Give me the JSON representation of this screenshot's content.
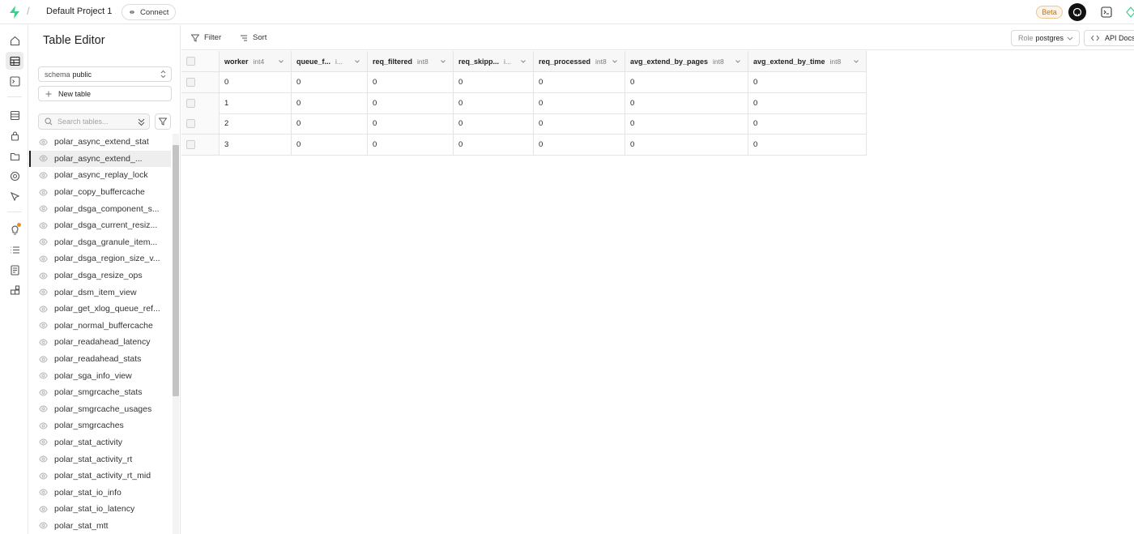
{
  "topbar": {
    "project": "Default Project 1",
    "connect": "Connect",
    "beta": "Beta"
  },
  "sidebar": {
    "title": "Table Editor",
    "schema_label": "schema",
    "schema_value": "public",
    "new_table": "New table",
    "search_placeholder": "Search tables...",
    "tables": [
      "polar_async_extend_stat",
      "polar_async_extend_...",
      "polar_async_replay_lock",
      "polar_copy_buffercache",
      "polar_dsga_component_s...",
      "polar_dsga_current_resiz...",
      "polar_dsga_granule_item...",
      "polar_dsga_region_size_v...",
      "polar_dsga_resize_ops",
      "polar_dsm_item_view",
      "polar_get_xlog_queue_ref...",
      "polar_normal_buffercache",
      "polar_readahead_latency",
      "polar_readahead_stats",
      "polar_sga_info_view",
      "polar_smgrcache_stats",
      "polar_smgrcache_usages",
      "polar_smgrcaches",
      "polar_stat_activity",
      "polar_stat_activity_rt",
      "polar_stat_activity_rt_mid",
      "polar_stat_io_info",
      "polar_stat_io_latency",
      "polar_stat_mtt"
    ],
    "active_index": 1
  },
  "toolbar": {
    "filter": "Filter",
    "sort": "Sort",
    "role_label": "Role",
    "role_value": "postgres",
    "api_docs": "API Docs"
  },
  "grid": {
    "columns": [
      {
        "name": "worker",
        "type": "int4"
      },
      {
        "name": "queue_f...",
        "type": "i..."
      },
      {
        "name": "req_filtered",
        "type": "int8"
      },
      {
        "name": "req_skipp...",
        "type": "i..."
      },
      {
        "name": "req_processed",
        "type": "int8"
      },
      {
        "name": "avg_extend_by_pages",
        "type": "int8"
      },
      {
        "name": "avg_extend_by_time",
        "type": "int8"
      }
    ],
    "rows": [
      [
        "0",
        "0",
        "0",
        "0",
        "0",
        "0",
        "0"
      ],
      [
        "1",
        "0",
        "0",
        "0",
        "0",
        "0",
        "0"
      ],
      [
        "2",
        "0",
        "0",
        "0",
        "0",
        "0",
        "0"
      ],
      [
        "3",
        "0",
        "0",
        "0",
        "0",
        "0",
        "0"
      ]
    ]
  }
}
